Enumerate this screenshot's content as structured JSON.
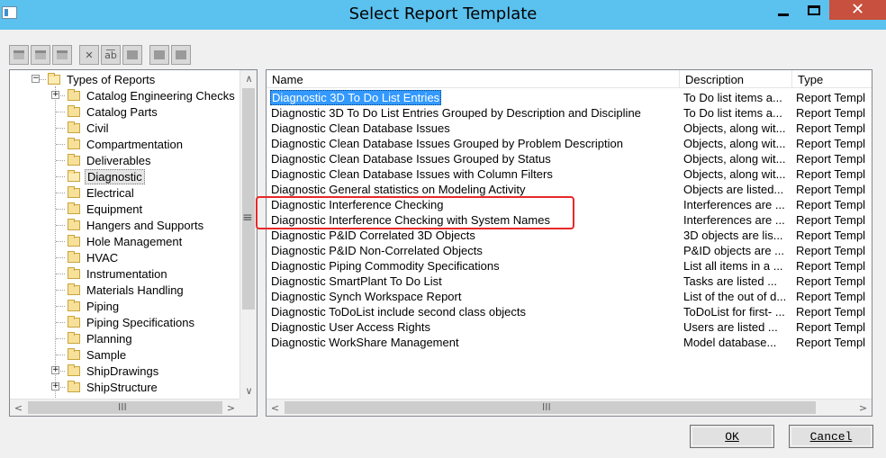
{
  "window": {
    "title": "Select Report Template",
    "close_glyph": "✕"
  },
  "toolbar": {
    "buttons": [
      {
        "icon": "new-folder-icon"
      },
      {
        "icon": "new-item-icon"
      },
      {
        "icon": "properties-icon"
      },
      {
        "icon": "delete-icon",
        "glyph": "✕"
      },
      {
        "icon": "rename-icon",
        "glyph": "a͞b"
      },
      {
        "icon": "edit-icon"
      },
      {
        "icon": "list-view-icon"
      },
      {
        "icon": "details-view-icon"
      }
    ]
  },
  "tree": {
    "root": "Types of Reports",
    "items": [
      {
        "label": "Catalog Engineering Checks",
        "expandable": true
      },
      {
        "label": "Catalog Parts",
        "expandable": false
      },
      {
        "label": "Civil",
        "expandable": false
      },
      {
        "label": "Compartmentation",
        "expandable": false
      },
      {
        "label": "Deliverables",
        "expandable": false
      },
      {
        "label": "Diagnostic",
        "expandable": false,
        "selected": true
      },
      {
        "label": "Electrical",
        "expandable": false
      },
      {
        "label": "Equipment",
        "expandable": false
      },
      {
        "label": "Hangers and Supports",
        "expandable": false
      },
      {
        "label": "Hole Management",
        "expandable": false
      },
      {
        "label": "HVAC",
        "expandable": false
      },
      {
        "label": "Instrumentation",
        "expandable": false
      },
      {
        "label": "Materials Handling",
        "expandable": false
      },
      {
        "label": "Piping",
        "expandable": false
      },
      {
        "label": "Piping Specifications",
        "expandable": false
      },
      {
        "label": "Planning",
        "expandable": false
      },
      {
        "label": "Sample",
        "expandable": false
      },
      {
        "label": "ShipDrawings",
        "expandable": true
      },
      {
        "label": "ShipStructure",
        "expandable": true
      }
    ]
  },
  "list": {
    "columns": [
      "Name",
      "Description",
      "Type"
    ],
    "rows": [
      {
        "name": "Diagnostic 3D To Do List Entries",
        "description": "To Do list items a...",
        "type": "Report Templ",
        "selected": true
      },
      {
        "name": "Diagnostic 3D To Do List Entries Grouped by Description and Discipline",
        "description": "To Do list items a...",
        "type": "Report Templ"
      },
      {
        "name": "Diagnostic Clean Database Issues",
        "description": "Objects, along wit...",
        "type": "Report Templ"
      },
      {
        "name": "Diagnostic Clean Database Issues Grouped by Problem Description",
        "description": "Objects, along wit...",
        "type": "Report Templ"
      },
      {
        "name": "Diagnostic Clean Database Issues Grouped by Status",
        "description": "Objects, along wit...",
        "type": "Report Templ"
      },
      {
        "name": "Diagnostic Clean Database Issues with Column Filters",
        "description": "Objects, along wit...",
        "type": "Report Templ"
      },
      {
        "name": "Diagnostic General statistics on Modeling Activity",
        "description": "Objects are listed...",
        "type": "Report Templ"
      },
      {
        "name": "Diagnostic Interference Checking",
        "description": "Interferences are ...",
        "type": "Report Templ"
      },
      {
        "name": "Diagnostic Interference Checking with System Names",
        "description": "Interferences are ...",
        "type": "Report Templ"
      },
      {
        "name": "Diagnostic P&ID Correlated 3D Objects",
        "description": "3D objects are lis...",
        "type": "Report Templ"
      },
      {
        "name": "Diagnostic P&ID Non-Correlated Objects",
        "description": "P&ID objects are ...",
        "type": "Report Templ"
      },
      {
        "name": "Diagnostic Piping Commodity Specifications",
        "description": "List all items in a ...",
        "type": "Report Templ"
      },
      {
        "name": "Diagnostic SmartPlant To Do List",
        "description": "Tasks are listed ...",
        "type": "Report Templ"
      },
      {
        "name": "Diagnostic Synch Workspace Report",
        "description": "List of the out of d...",
        "type": "Report Templ"
      },
      {
        "name": "Diagnostic ToDoList include second class objects",
        "description": "ToDoList for first- ...",
        "type": "Report Templ"
      },
      {
        "name": "Diagnostic User Access Rights",
        "description": "Users are listed ...",
        "type": "Report Templ"
      },
      {
        "name": "Diagnostic WorkShare Management",
        "description": "Model database...",
        "type": "Report Templ"
      }
    ]
  },
  "buttons": {
    "ok": "OK",
    "cancel": "Cancel"
  },
  "scroll": {
    "up": "∧",
    "down": "∨",
    "left": "<",
    "right": ">",
    "grip": "III",
    "splitter": "≡"
  }
}
